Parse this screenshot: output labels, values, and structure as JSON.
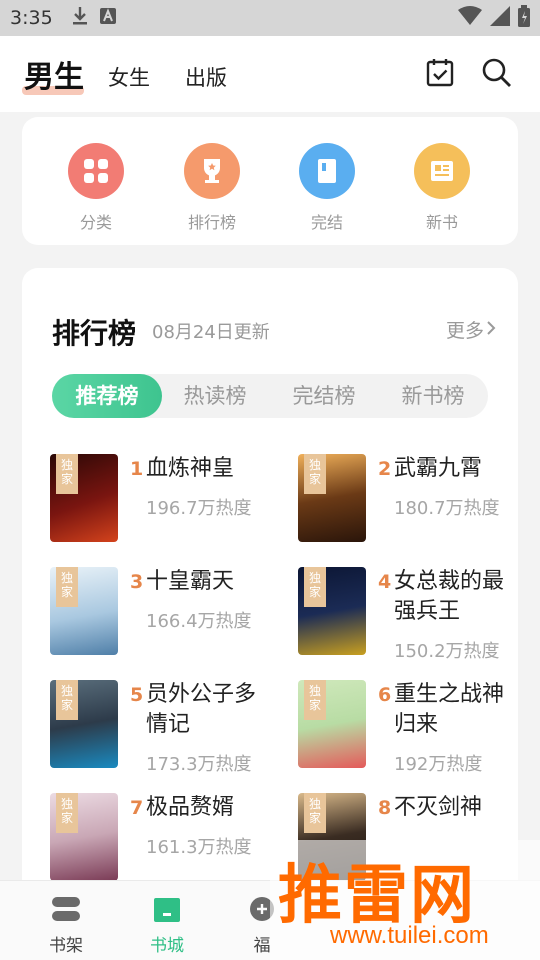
{
  "status_bar": {
    "time": "3:35"
  },
  "top_nav": {
    "tabs": [
      {
        "label": "男生",
        "active": true
      },
      {
        "label": "女生",
        "active": false
      },
      {
        "label": "出版",
        "active": false
      }
    ],
    "icons": [
      "checkin-icon",
      "search-icon"
    ]
  },
  "quick_entries": [
    {
      "label": "分类",
      "icon": "category-icon",
      "color": "#f27c74"
    },
    {
      "label": "排行榜",
      "icon": "trophy-icon",
      "color": "#f59a6c"
    },
    {
      "label": "完结",
      "icon": "book-icon",
      "color": "#5aaef0"
    },
    {
      "label": "新书",
      "icon": "newbook-icon",
      "color": "#f5bf5a"
    }
  ],
  "ranking": {
    "title": "排行榜",
    "updated": "08月24日更新",
    "more": "更多",
    "tabs": [
      "推荐榜",
      "热读榜",
      "完结榜",
      "新书榜"
    ],
    "active_tab": 0,
    "books": [
      {
        "rank": "1",
        "title": "血炼神皇",
        "heat": "196.7万热度",
        "tag": "独家",
        "cover_color": "#7a1510"
      },
      {
        "rank": "2",
        "title": "武霸九霄",
        "heat": "180.7万热度",
        "tag": "独家",
        "cover_color": "#6b3a16"
      },
      {
        "rank": "3",
        "title": "十皇霸天",
        "heat": "166.4万热度",
        "tag": "独家",
        "cover_color": "#a9c8e0"
      },
      {
        "rank": "4",
        "title": "女总裁的最强兵王",
        "heat": "150.2万热度",
        "tag": "独家",
        "cover_color": "#1b2b55"
      },
      {
        "rank": "5",
        "title": "员外公子多情记",
        "heat": "173.3万热度",
        "tag": "独家",
        "cover_color": "#2d3b4a"
      },
      {
        "rank": "6",
        "title": "重生之战神归来",
        "heat": "192万热度",
        "tag": "独家",
        "cover_color": "#b8dca4"
      },
      {
        "rank": "7",
        "title": "极品赘婿",
        "heat": "161.3万热度",
        "tag": "独家",
        "cover_color": "#c9a7b5"
      },
      {
        "rank": "8",
        "title": "不灭剑神",
        "heat": "",
        "tag": "独家",
        "cover_color": "#3a2c22"
      }
    ]
  },
  "bottom_nav": [
    {
      "label": "书架",
      "icon": "bookshelf-icon",
      "active": false
    },
    {
      "label": "书城",
      "icon": "bookstore-icon",
      "active": true
    },
    {
      "label": "福",
      "icon": "welfare-icon",
      "active": false
    }
  ],
  "watermark": {
    "text": "推雷网",
    "url": "www.tuilei.com"
  },
  "colors": {
    "accent": "#3ec48f",
    "rank_number": "#e6864a"
  }
}
